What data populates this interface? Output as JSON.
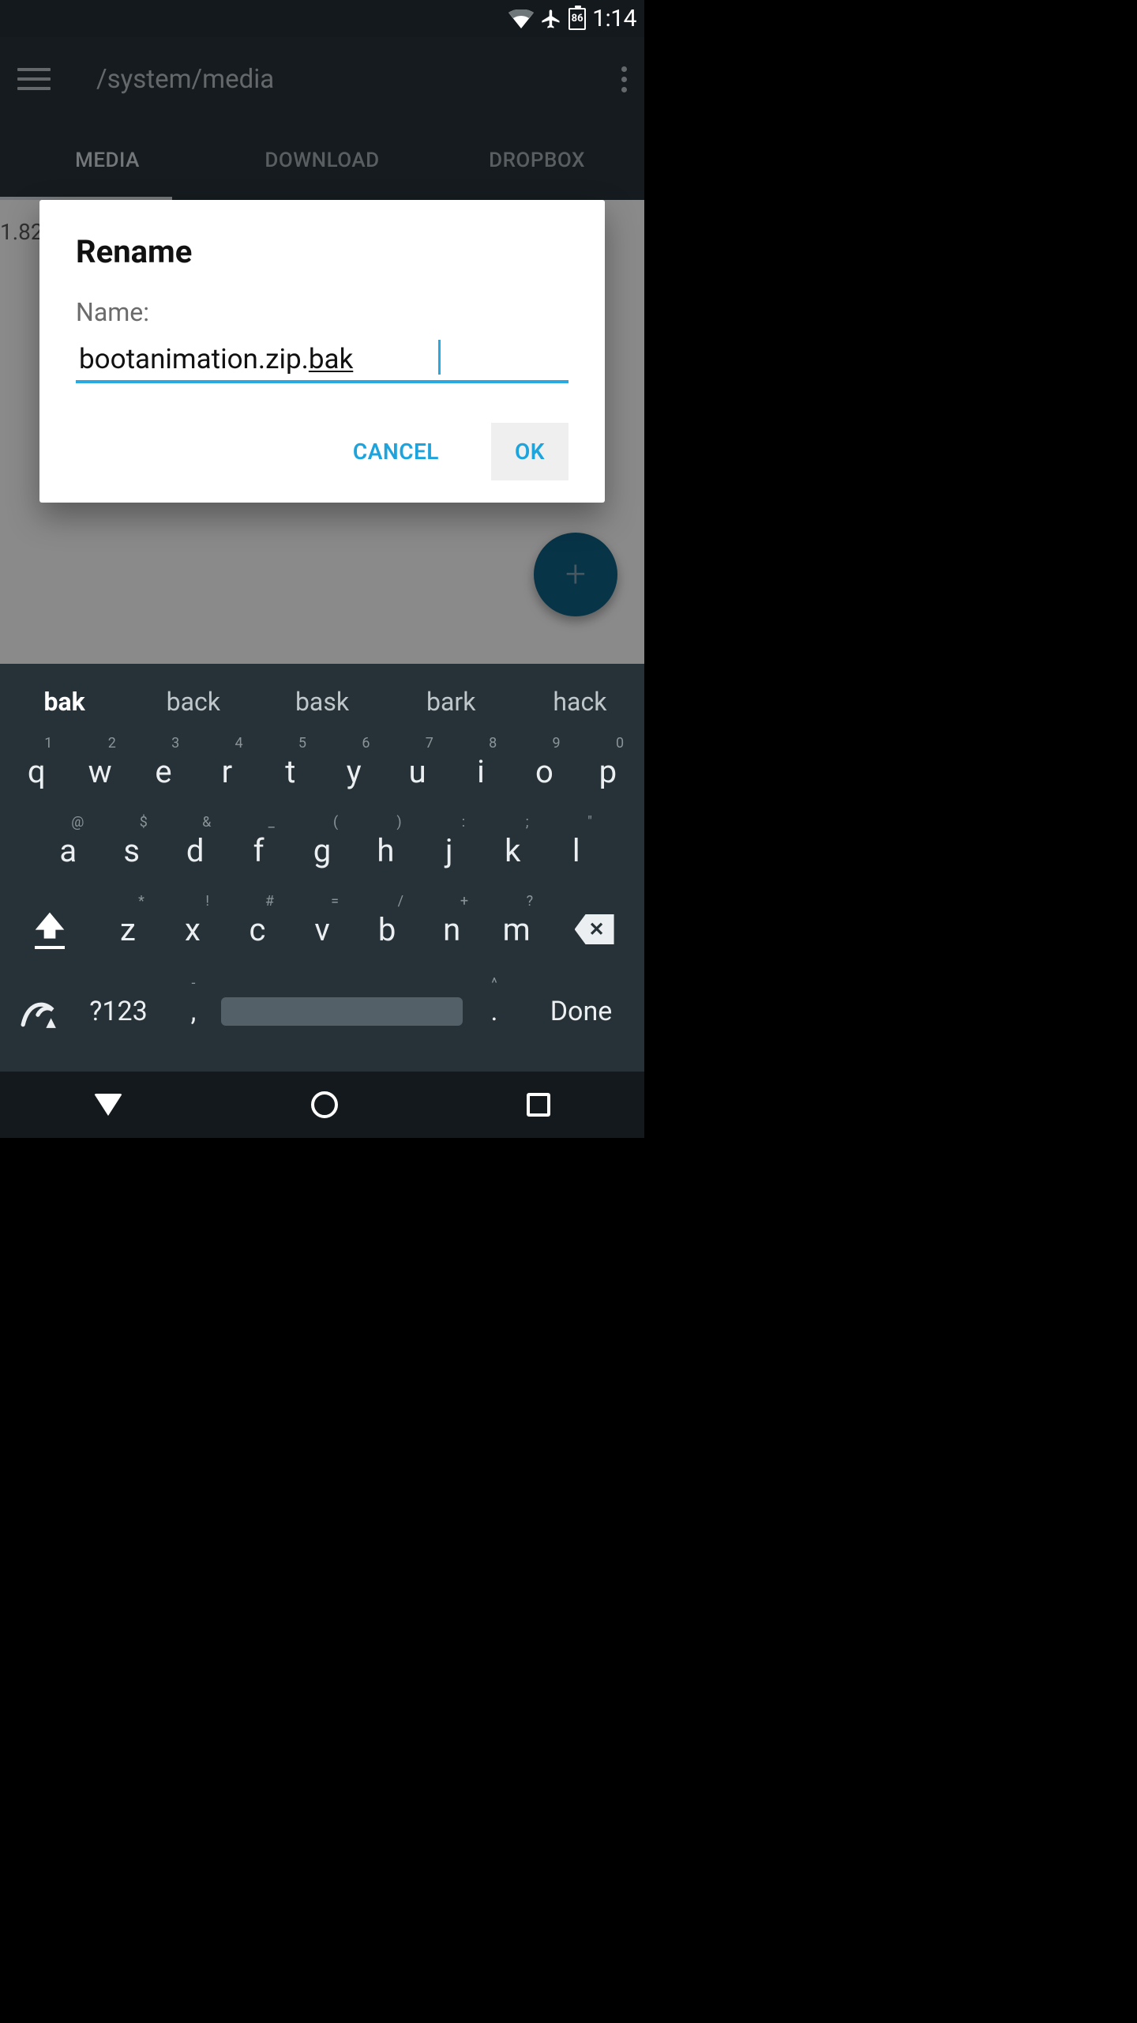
{
  "status": {
    "time": "1:14",
    "battery_pct": "86"
  },
  "toolbar": {
    "path": "/system/media"
  },
  "tabs": [
    "MEDIA",
    "DOWNLOAD",
    "DROPBOX"
  ],
  "active_tab_index": 0,
  "content": {
    "size_fragment": "1.82"
  },
  "dialog": {
    "title": "Rename",
    "field_label": "Name:",
    "value_prefix": "bootanimation.zip.",
    "value_suffix": "bak",
    "cancel": "CANCEL",
    "ok": "OK"
  },
  "keyboard": {
    "suggestions": [
      "bak",
      "back",
      "bask",
      "bark",
      "hack"
    ],
    "selected_suggestion_index": 0,
    "row1": [
      {
        "main": "q",
        "hint": "1"
      },
      {
        "main": "w",
        "hint": "2"
      },
      {
        "main": "e",
        "hint": "3"
      },
      {
        "main": "r",
        "hint": "4"
      },
      {
        "main": "t",
        "hint": "5"
      },
      {
        "main": "y",
        "hint": "6"
      },
      {
        "main": "u",
        "hint": "7"
      },
      {
        "main": "i",
        "hint": "8"
      },
      {
        "main": "o",
        "hint": "9"
      },
      {
        "main": "p",
        "hint": "0"
      }
    ],
    "row2": [
      {
        "main": "a",
        "hint": "@"
      },
      {
        "main": "s",
        "hint": "$"
      },
      {
        "main": "d",
        "hint": "&"
      },
      {
        "main": "f",
        "hint": "_"
      },
      {
        "main": "g",
        "hint": "("
      },
      {
        "main": "h",
        "hint": ")"
      },
      {
        "main": "j",
        "hint": ":"
      },
      {
        "main": "k",
        "hint": ";"
      },
      {
        "main": "l",
        "hint": "\""
      }
    ],
    "row3": [
      {
        "main": "z",
        "hint": "*"
      },
      {
        "main": "x",
        "hint": "!"
      },
      {
        "main": "c",
        "hint": "#"
      },
      {
        "main": "v",
        "hint": "="
      },
      {
        "main": "b",
        "hint": "/"
      },
      {
        "main": "n",
        "hint": "+"
      },
      {
        "main": "m",
        "hint": "?"
      }
    ],
    "numkey": "?123",
    "comma": ",",
    "comma_hint": "-",
    "dot": ".",
    "dot_hint": "^",
    "done": "Done"
  }
}
